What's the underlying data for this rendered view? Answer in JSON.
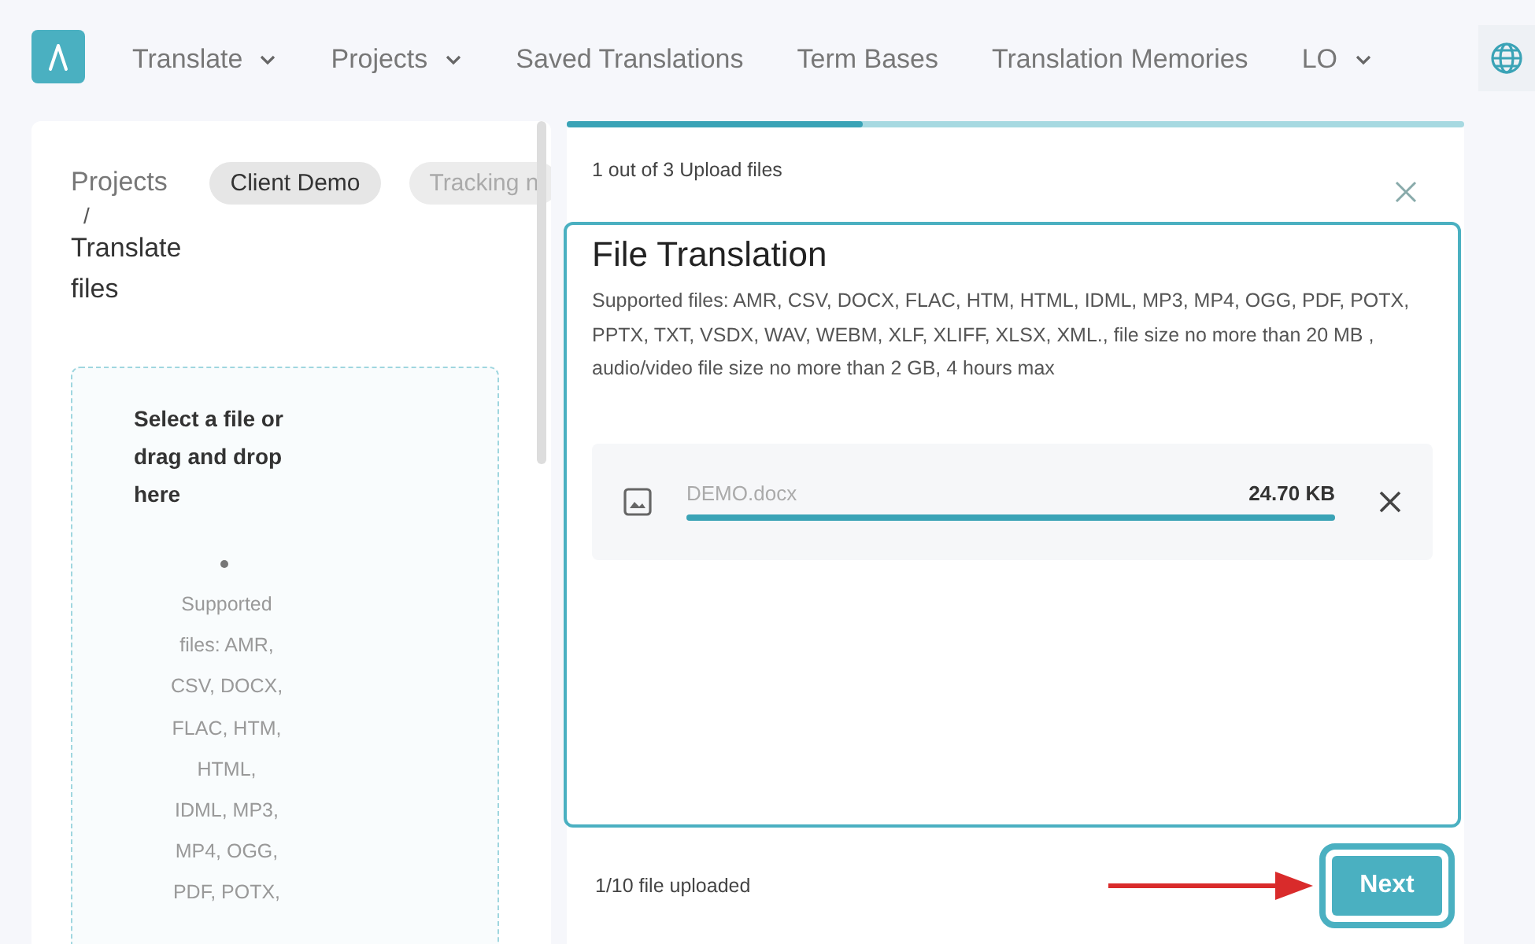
{
  "nav": {
    "items": [
      {
        "label": "Translate",
        "dropdown": true
      },
      {
        "label": "Projects",
        "dropdown": true
      },
      {
        "label": "Saved Translations",
        "dropdown": false
      },
      {
        "label": "Term Bases",
        "dropdown": false
      },
      {
        "label": "Translation Memories",
        "dropdown": false
      },
      {
        "label": "LO",
        "dropdown": true
      }
    ]
  },
  "breadcrumb": {
    "items": [
      "Projects",
      "Translate files"
    ],
    "separator": "/"
  },
  "chips": [
    {
      "label": "Client Demo",
      "selected": true
    },
    {
      "label": "Tracking n",
      "selected": false
    }
  ],
  "dropzone": {
    "title": "Select a file or drag and drop here",
    "hint": "Supported files: AMR, CSV, DOCX, FLAC, HTM, HTML, IDML, MP3, MP4, OGG, PDF, POTX,"
  },
  "modal": {
    "step": "1 out of 3 Upload files",
    "level": 0.33,
    "title": "File Translation",
    "description": "Supported files: AMR, CSV, DOCX, FLAC, HTM, HTML, IDML, MP3, MP4, OGG, PDF, POTX, PPTX, TXT, VSDX, WAV, WEBM, XLF, XLIFF, XLSX, XML., file size no more than 20 MB , audio/video file size no more than 2 GB, 4 hours max",
    "files": [
      {
        "name": "DEMO.docx",
        "size": "24.70 KB",
        "level": 1
      }
    ],
    "status": "1/10 file uploaded",
    "button": "Next"
  }
}
